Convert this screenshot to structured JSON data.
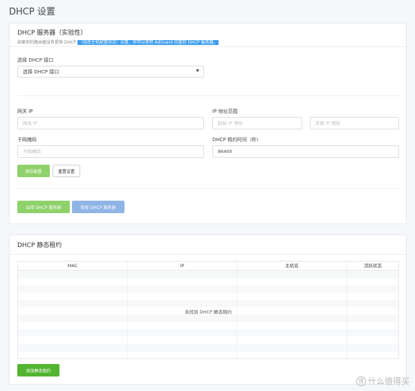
{
  "page_title": "DHCP 设置",
  "server_card": {
    "title": "DHCP 服务器（实验性）",
    "subtitle_prefix": "如果你的路由器没有提供 DHCP ",
    "subtitle_highlight": "（动态主机配置协议）设置，你可以使用 AdGuard 内置的 DHCP 服务器。",
    "interface_label": "选择 DHCP 接口",
    "interface_select_value": "选择 DHCP 接口",
    "gateway_label": "网关 IP",
    "gateway_placeholder": "网关 IP",
    "ip_range_label": "IP 地址范围",
    "range_start_placeholder": "起始 IP 地址",
    "range_end_placeholder": "末尾 IP 地址",
    "subnet_label": "子网掩码",
    "subnet_placeholder": "子网掩码",
    "lease_label": "DHCP 租约时间（秒）",
    "lease_value": "86400",
    "save_button": "保存配置",
    "reset_button": "重置设置",
    "enable_button": "启用 DHCP 服务器",
    "check_button": "检查 DHCP 服务器"
  },
  "static_card": {
    "title": "DHCP 静态租约",
    "columns": [
      "MAC",
      "IP",
      "主机名",
      "活跃状态"
    ],
    "empty_text": "未找到 DHCP 静态租约",
    "add_button": "添加静态租约"
  },
  "watermark": {
    "logo_glyph": "值",
    "text": "什么值得买"
  }
}
